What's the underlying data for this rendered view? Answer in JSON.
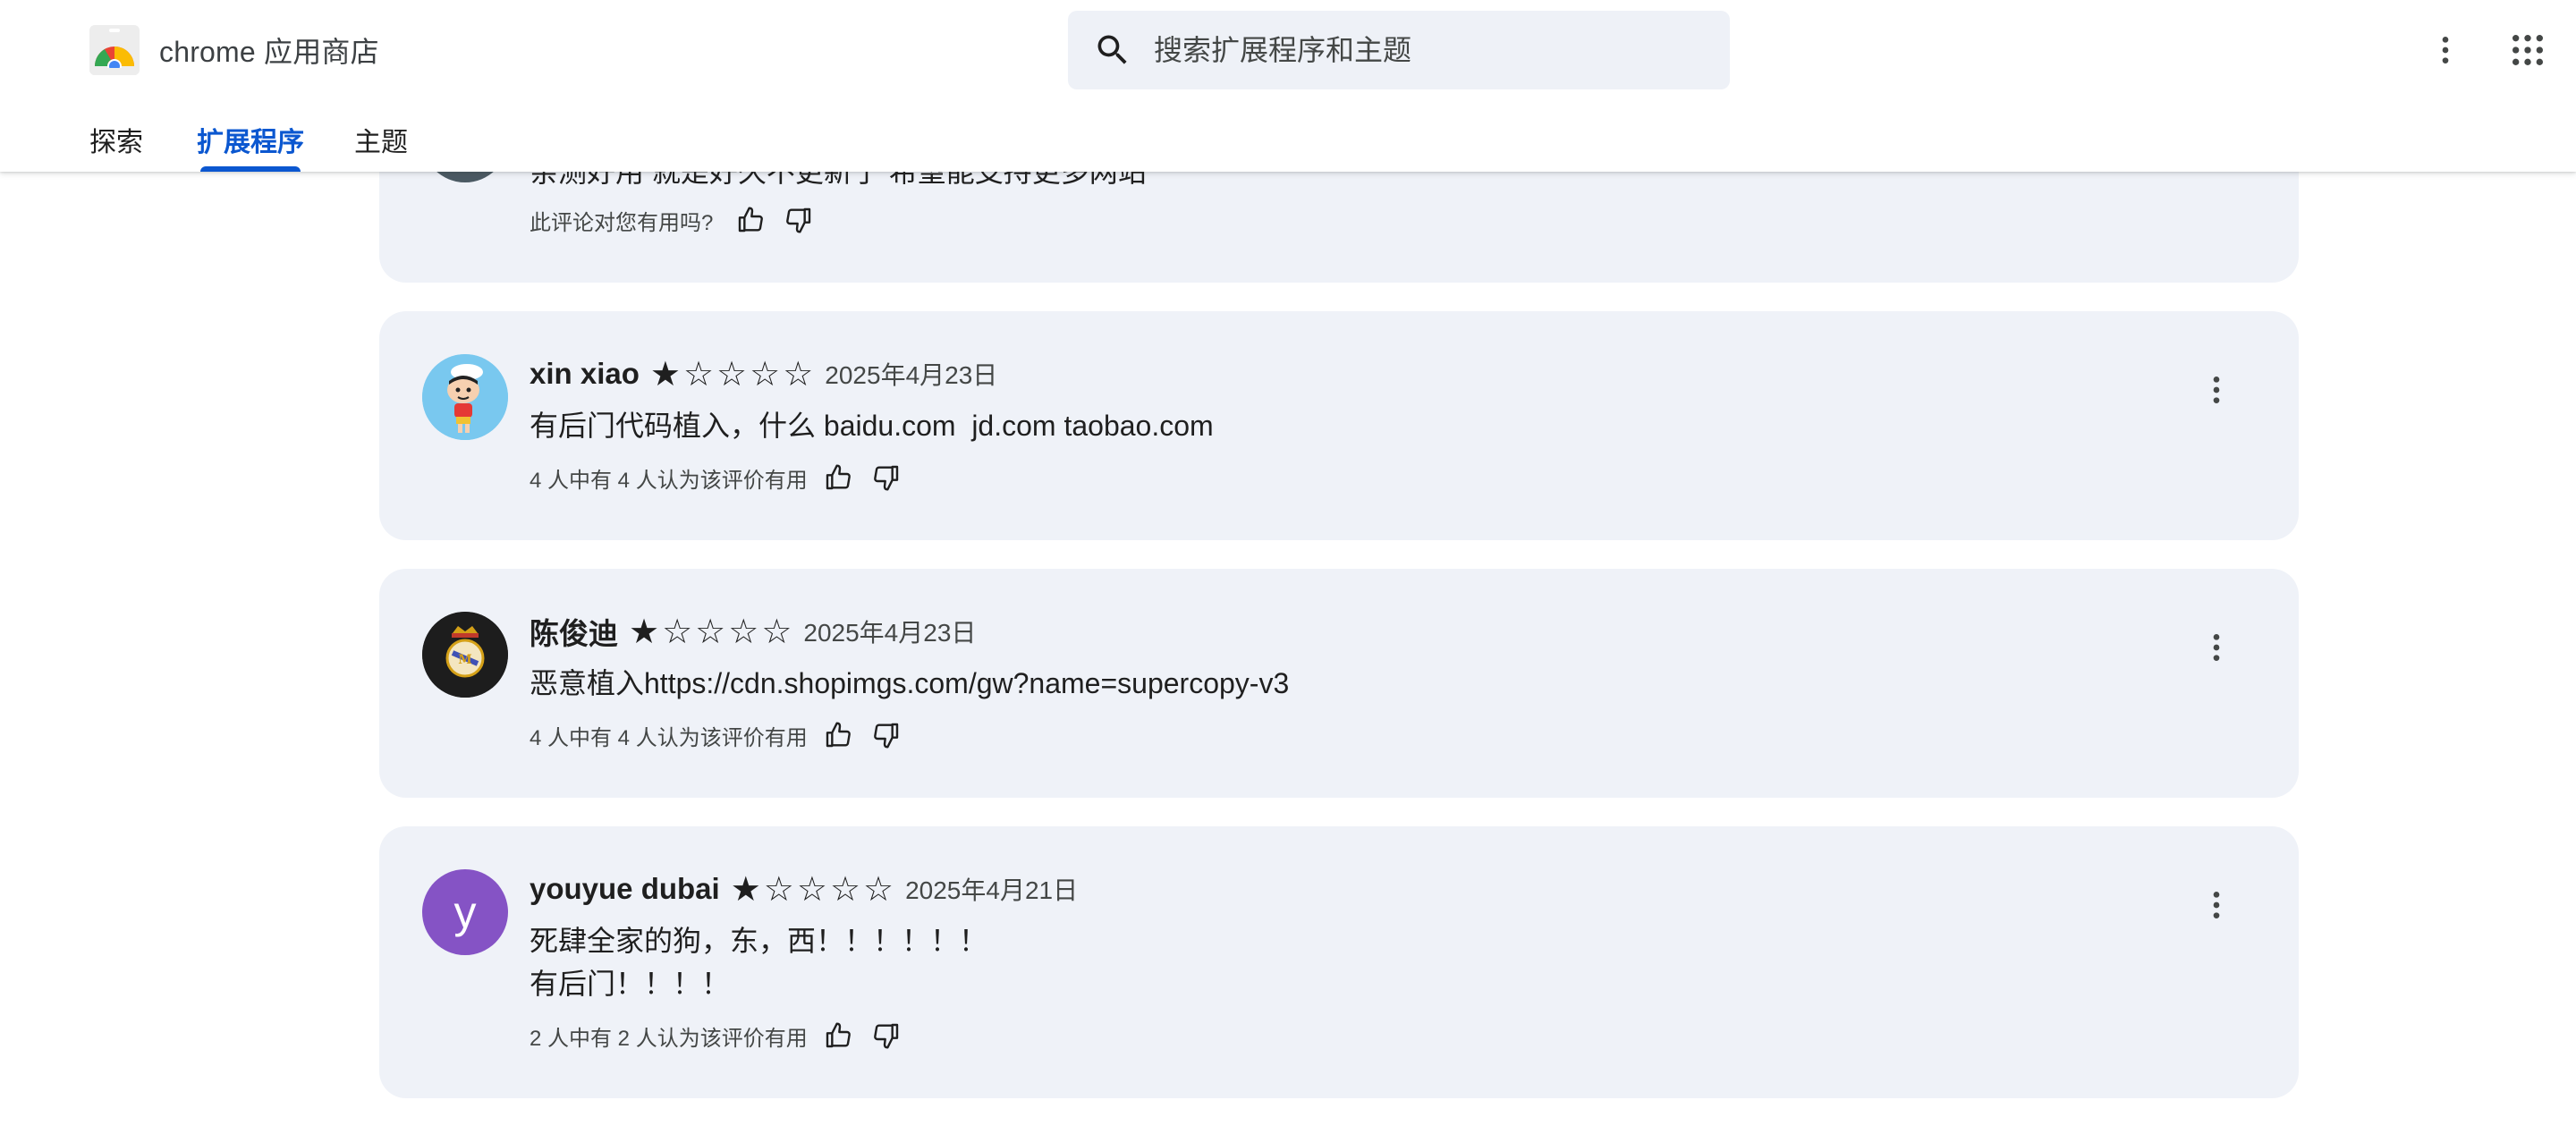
{
  "app": {
    "name": "chrome 应用商店"
  },
  "search": {
    "placeholder": "搜索扩展程序和主题"
  },
  "nav": {
    "tabs": [
      {
        "label": "探索",
        "active": false
      },
      {
        "label": "扩展程序",
        "active": true
      },
      {
        "label": "主题",
        "active": false
      }
    ]
  },
  "colors": {
    "accent": "#0b57d0",
    "card_bg": "#eff2f8",
    "avatar_purple": "#8553c5"
  },
  "reviews": [
    {
      "author": "",
      "text": "亲测好用 就是好久不更新了 希望能支持更多网站",
      "helpful": "此评论对您有用吗?",
      "avatar": "partially-hidden-avatar"
    },
    {
      "author": "xin xiao",
      "rating": 1,
      "max_rating": 5,
      "date": "2025年4月23日",
      "text": "有后门代码植入，什么 baidu.com  jd.com taobao.com",
      "helpful": "4 人中有 4 人认为该评价有用",
      "avatar": "cartoon-boy-avatar"
    },
    {
      "author": "陈俊迪",
      "rating": 1,
      "max_rating": 5,
      "date": "2025年4月23日",
      "text": "恶意植入https://cdn.shopimgs.com/gw?name=supercopy-v3",
      "helpful": "4 人中有 4 人认为该评价有用",
      "avatar": "crest-avatar"
    },
    {
      "author": "youyue dubai",
      "rating": 1,
      "max_rating": 5,
      "date": "2025年4月21日",
      "text_lines": [
        "死肆全家的狗，东，西！！！！！！",
        "有后门！！！！"
      ],
      "helpful": "2 人中有 2 人认为该评价有用",
      "avatar_letter": "y"
    }
  ],
  "icons": {
    "thumb_up": "thumb-up-icon",
    "thumb_down": "thumb-down-icon",
    "more": "more-vert-icon",
    "apps": "apps-grid-icon",
    "search": "search-icon"
  }
}
